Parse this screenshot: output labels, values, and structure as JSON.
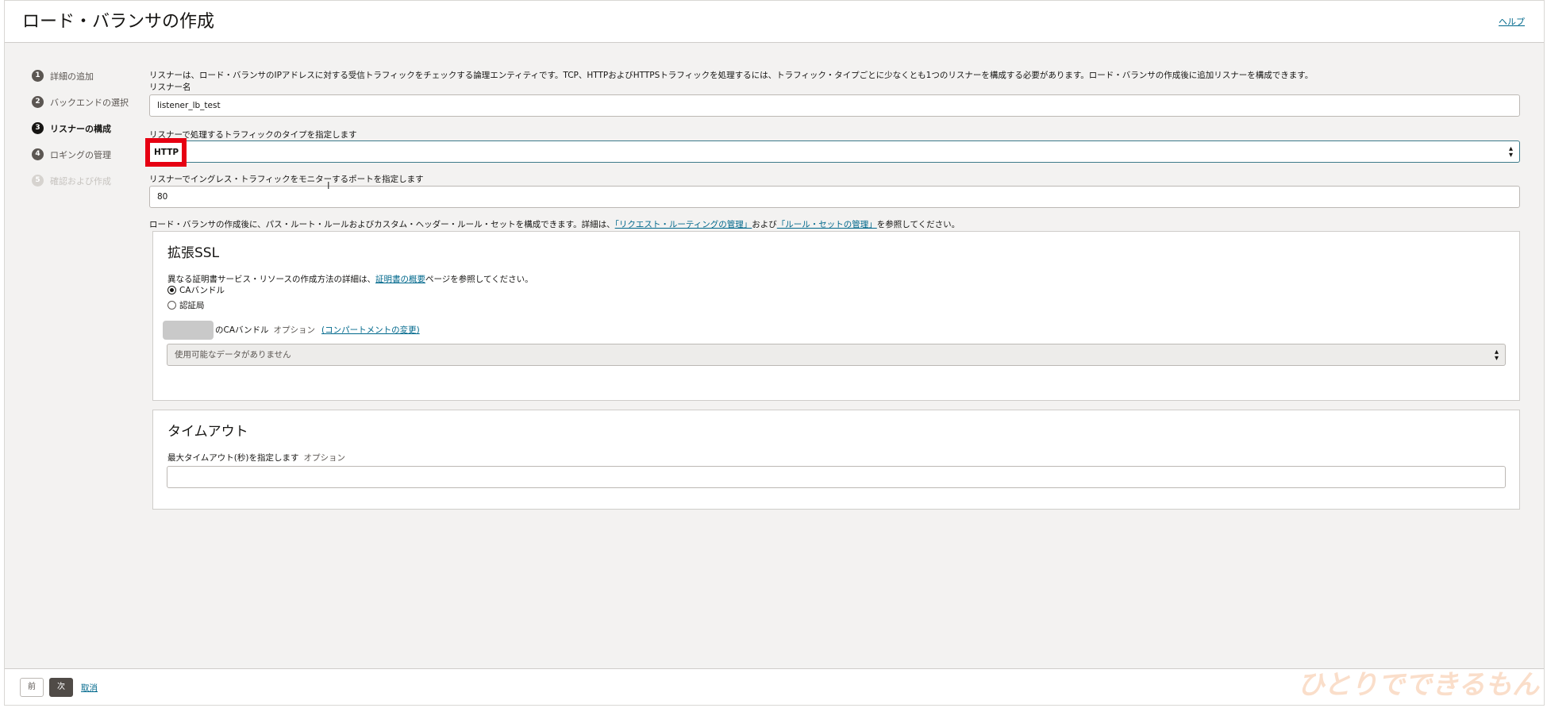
{
  "header": {
    "title": "ロード・バランサの作成",
    "help_label": "ヘルプ"
  },
  "steps": [
    {
      "num": "1",
      "label": "詳細の追加"
    },
    {
      "num": "2",
      "label": "バックエンドの選択"
    },
    {
      "num": "3",
      "label": "リスナーの構成"
    },
    {
      "num": "4",
      "label": "ロギングの管理"
    },
    {
      "num": "5",
      "label": "確認および作成"
    }
  ],
  "listener": {
    "description": "リスナーは、ロード・バランサのIPアドレスに対する受信トラフィックをチェックする論理エンティティです。TCP、HTTPおよびHTTPSトラフィックを処理するには、トラフィック・タイプごとに少なくとも1つのリスナーを構成する必要があります。ロード・バランサの作成後に追加リスナーを構成できます。",
    "name_label": "リスナー名",
    "name_value": "listener_lb_test",
    "traffic_label": "リスナーで処理するトラフィックのタイプを指定します",
    "traffic_value": "HTTP",
    "port_label": "リスナーでイングレス・トラフィックをモニターするポートを指定します",
    "port_value": "80"
  },
  "routing": {
    "text_before": "ロード・バランサの作成後に、パス・ルート・ルールおよびカスタム・ヘッダー・ルール・セットを構成できます。詳細は、",
    "link1": "「リクエスト・ルーティングの管理」",
    "text_middle": "および",
    "link2": "「ルール・セットの管理」",
    "text_after": "を参照してください。"
  },
  "ssl": {
    "title": "拡張SSL",
    "desc_before": "異なる証明書サービス・リソースの作成方法の詳細は、",
    "desc_link": "証明書の概要",
    "desc_after": "ページを参照してください。",
    "radio_ca": "CAバンドル",
    "radio_authority": "認証局",
    "bundle_label": "のCAバンドル",
    "bundle_optional": "オプション",
    "change_compartment": "(コンパートメントの変更)",
    "select_placeholder": "使用可能なデータがありません"
  },
  "timeout": {
    "title": "タイムアウト",
    "label": "最大タイムアウト(秒)を指定します",
    "optional": "オプション",
    "value": ""
  },
  "footer": {
    "prev_label": "前",
    "next_label": "次",
    "cancel_label": "取消"
  },
  "watermark": "ひとりでできるもん",
  "colors": {
    "accent_link": "#00688c",
    "highlight_box": "#e60012"
  }
}
